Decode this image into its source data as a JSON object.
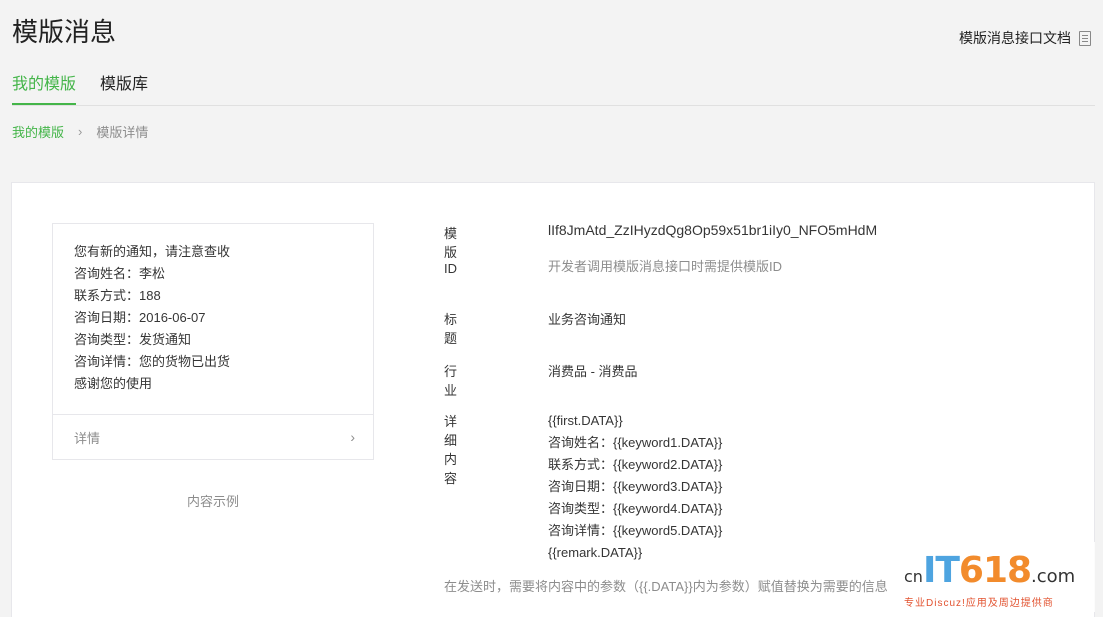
{
  "header": {
    "title": "模版消息",
    "doc_link": "模版消息接口文档",
    "doc_icon": "document-icon"
  },
  "tabs": [
    {
      "label": "我的模版",
      "active": true
    },
    {
      "label": "模版库",
      "active": false
    }
  ],
  "breadcrumb": {
    "parent": "我的模版",
    "separator": "›",
    "current": "模版详情"
  },
  "preview": {
    "lines": [
      "您有新的通知，请注意查收",
      "咨询姓名：李松",
      "联系方式：188",
      "咨询日期：2016-06-07",
      "咨询类型：发货通知",
      "咨询详情：您的货物已出货",
      "感谢您的使用"
    ],
    "detail_label": "详情",
    "detail_chevron": "›",
    "caption": "内容示例"
  },
  "info": {
    "id_label": "模版ID",
    "id_value": "lIf8JmAtd_ZzIHyzdQg8Op59x51br1iIy0_NFO5mHdM",
    "id_hint": "开发者调用模版消息接口时需提供模版ID",
    "title_label": "标题",
    "title_value": "业务咨询通知",
    "industry_label": "行业",
    "industry_value": "消费品 - 消费品",
    "content_label": "详细内容",
    "content_lines": [
      "{{first.DATA}}",
      "咨询姓名：{{keyword1.DATA}}",
      "联系方式：{{keyword2.DATA}}",
      "咨询日期：{{keyword3.DATA}}",
      "咨询类型：{{keyword4.DATA}}",
      "咨询详情：{{keyword5.DATA}}",
      "{{remark.DATA}}"
    ],
    "footnote": "在发送时，需要将内容中的参数（{{.DATA}}内为参数）赋值替换为需要的信息"
  },
  "watermark": {
    "cn": "cn",
    "it": "IT",
    "num": "618",
    "com": ".com",
    "sub": "专业Discuz!应用及周边提供商"
  },
  "colors": {
    "accent": "#44b549",
    "text": "#353535",
    "muted": "#8d8d8d",
    "border": "#e7e7eb",
    "background": "#f3f3f3"
  }
}
